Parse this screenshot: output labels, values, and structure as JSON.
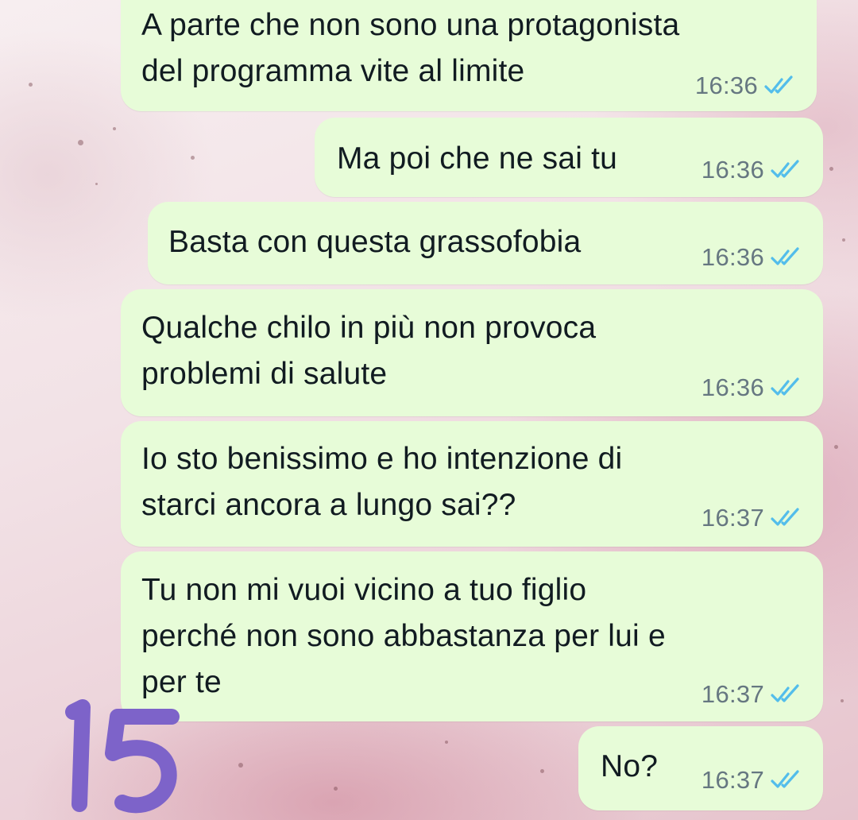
{
  "chat": {
    "messages": [
      {
        "text": "A parte che non sono una protagonista\ndel programma vite al limite",
        "time": "16:36",
        "status": "read"
      },
      {
        "text": "Ma poi che ne sai tu",
        "time": "16:36",
        "status": "read"
      },
      {
        "text": "Basta con questa grassofobia",
        "time": "16:36",
        "status": "read"
      },
      {
        "text": "Qualche chilo in più non provoca\nproblemi di salute",
        "time": "16:36",
        "status": "read"
      },
      {
        "text": "Io sto benissimo e ho intenzione di\nstarci ancora a lungo sai??",
        "time": "16:37",
        "status": "read"
      },
      {
        "text": "Tu non mi vuoi vicino a tuo figlio\nperché non sono abbastanza per lui e\nper te",
        "time": "16:37",
        "status": "read"
      },
      {
        "text": "No?",
        "time": "16:37",
        "status": "read"
      }
    ]
  },
  "overlay": {
    "handwritten_number": "15",
    "ink_color": "#7d63c9"
  },
  "colors": {
    "bubble": "#e7fcd8",
    "tick_read": "#53bdeb",
    "time": "#667781",
    "text": "#111b21"
  },
  "icons": {
    "read_receipt": "double-check-icon"
  }
}
